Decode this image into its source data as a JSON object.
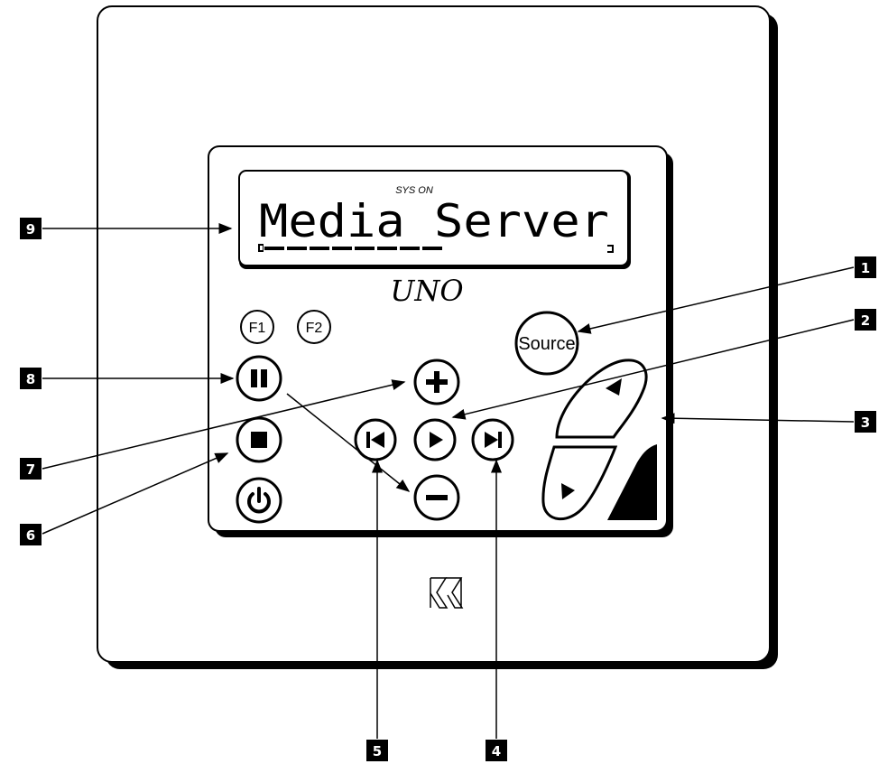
{
  "display": {
    "status_text": "SYS ON",
    "main_text": "Media Server",
    "progress_fraction": 0.55
  },
  "brand": {
    "model_logo": "UNO"
  },
  "buttons": {
    "f1": "F1",
    "f2": "F2",
    "source": "Source"
  },
  "callouts": [
    "1",
    "2",
    "3",
    "4",
    "5",
    "6",
    "7",
    "8",
    "9"
  ]
}
